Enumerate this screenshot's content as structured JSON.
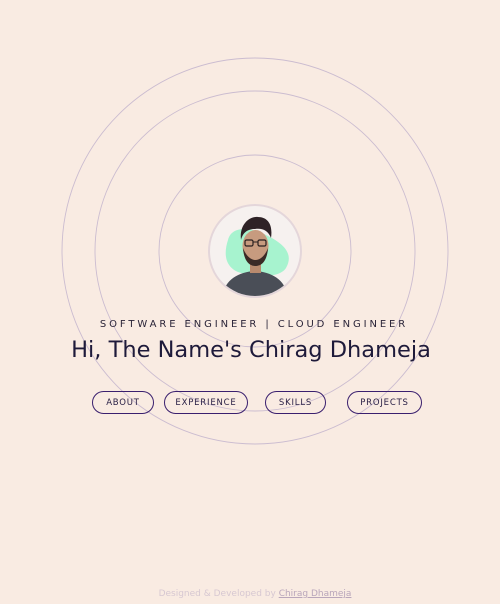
{
  "hero": {
    "subtitle": "SOFTWARE ENGINEER | CLOUD ENGINEER",
    "title": "Hi, The Name's Chirag Dhameja",
    "avatar_alt": "profile photo"
  },
  "nav": {
    "about": "ABOUT",
    "experience": "EXPERIENCE",
    "skills": "SKILLS",
    "projects": "PROJECTS"
  },
  "footer": {
    "prefix": "Designed & Developed by ",
    "author": "Chirag Dhameja"
  },
  "colors": {
    "background": "#f9ebe2",
    "accent": "#3a1f6e",
    "ring": "#cbbcd0",
    "blob": "#a7f3cf"
  }
}
